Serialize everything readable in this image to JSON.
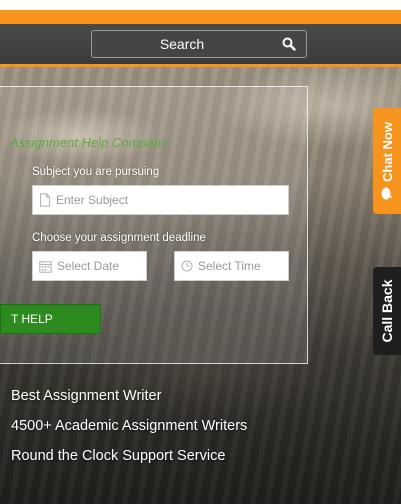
{
  "header": {
    "search": {
      "label": "Search",
      "icon": "search-icon"
    }
  },
  "form": {
    "title": "Assignment Help Company",
    "subject_label": "Subject you are pursuing",
    "subject_placeholder": "Enter Subject",
    "deadline_label": "Choose your assignment deadline",
    "date_placeholder": "Select Date",
    "time_placeholder": "Select Time",
    "submit_label": "T HELP",
    "icons": [
      "file-icon",
      "calendar-icon",
      "clock-icon"
    ]
  },
  "features": [
    "Best Assignment Writer",
    "4500+ Academic Assignment Writers",
    "Round the Clock Support Service"
  ],
  "side_tabs": {
    "chat": {
      "label": "Chat Now",
      "icon": "chat-icon"
    },
    "callback": {
      "label": "Call Back"
    }
  },
  "colors": {
    "accent": "#f7941d",
    "nav": "#3b3b3b",
    "title_green": "#5fa843",
    "button_green": "#2d8a1f"
  }
}
